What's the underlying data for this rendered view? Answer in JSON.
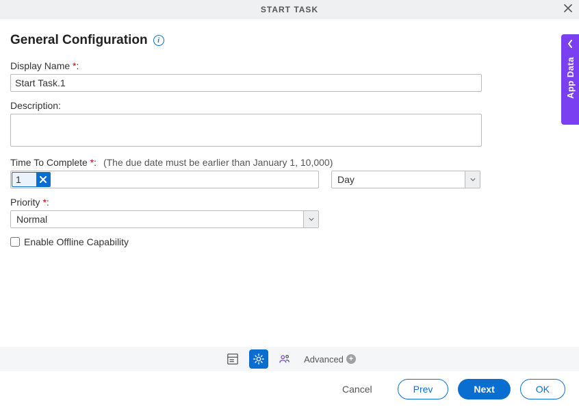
{
  "titlebar": {
    "title": "START TASK"
  },
  "section": {
    "heading": "General Configuration"
  },
  "fields": {
    "display_name": {
      "label": "Display Name",
      "value": "Start Task.1"
    },
    "description": {
      "label": "Description:",
      "value": ""
    },
    "time_to_complete": {
      "label": "Time To Complete",
      "hint": "(The due date must be earlier than January 1, 10,000)",
      "value": "1",
      "unit": "Day"
    },
    "priority": {
      "label": "Priority",
      "value": "Normal"
    },
    "enable_offline": {
      "label": "Enable Offline Capability",
      "checked": false
    }
  },
  "toolstrip": {
    "advanced_label": "Advanced"
  },
  "side_tab": {
    "label": "App Data"
  },
  "footer": {
    "cancel": "Cancel",
    "prev": "Prev",
    "next": "Next",
    "ok": "OK"
  }
}
